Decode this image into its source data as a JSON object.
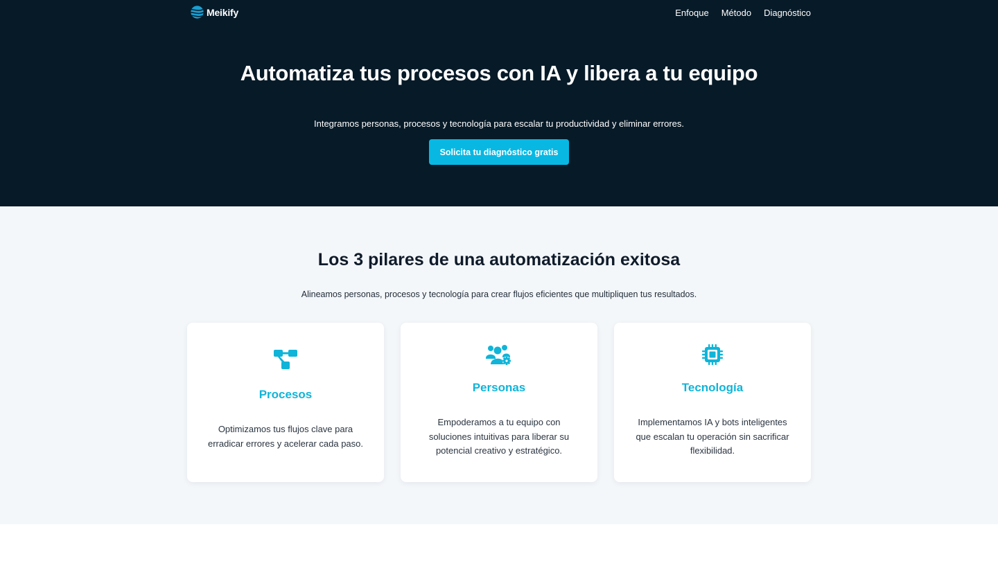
{
  "brand": {
    "name": "Meikify",
    "logo_icon": "wave-sphere-icon",
    "accent_color": "#08b8e3",
    "dark_bg": "#071a28"
  },
  "nav": {
    "links": [
      {
        "label": "Enfoque"
      },
      {
        "label": "Método"
      },
      {
        "label": "Diagnóstico"
      }
    ]
  },
  "hero": {
    "title": "Automatiza tus procesos con IA y libera a tu equipo",
    "subtitle": "Integramos personas, procesos y tecnología para escalar tu productividad y eliminar errores.",
    "cta_label": "Solicita tu diagnóstico gratis"
  },
  "pillars": {
    "title": "Los 3 pilares de una automatización exitosa",
    "subtitle": "Alineamos personas, procesos y tecnología para crear flujos eficientes que multipliquen tus resultados.",
    "cards": [
      {
        "icon": "flowchart-icon",
        "title": "Procesos",
        "text": "Optimizamos tus flujos clave para erradicar errores y acelerar cada paso."
      },
      {
        "icon": "users-gear-icon",
        "title": "Personas",
        "text": "Empoderamos a tu equipo con soluciones intuitivas para liberar su potencial creativo y estratégico."
      },
      {
        "icon": "microchip-icon",
        "title": "Tecnología",
        "text": "Implementamos IA y bots inteligentes que escalan tu operación sin sacrificar flexibilidad."
      }
    ]
  }
}
